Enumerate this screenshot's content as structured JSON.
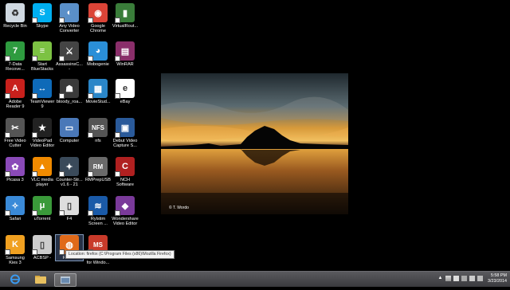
{
  "desktop_icons": [
    {
      "label": "Recycle Bin",
      "icon": "recycle-bin-icon",
      "color": "#cfd8e0",
      "glyph": "♻",
      "shortcut": false
    },
    {
      "label": "Skype",
      "icon": "skype-icon",
      "color": "#00aff0",
      "glyph": "S",
      "shortcut": true
    },
    {
      "label": "Any Video\nConverter",
      "icon": "any-video-converter-icon",
      "color": "#5a8fc8",
      "glyph": "◐",
      "shortcut": true
    },
    {
      "label": "Google\nChrome",
      "icon": "chrome-icon",
      "color": "#db4437",
      "glyph": "◉",
      "shortcut": true
    },
    {
      "label": "VirtualRout...",
      "icon": "virtual-router-icon",
      "color": "#3a7d3a",
      "glyph": "▮",
      "shortcut": true
    },
    {
      "label": "7-Data\nRecove...",
      "icon": "data-recovery-icon",
      "color": "#2e9b3f",
      "glyph": "7",
      "shortcut": true
    },
    {
      "label": "Start\nBlueStacks",
      "icon": "bluestacks-icon",
      "color": "#7cc243",
      "glyph": "≡",
      "shortcut": true
    },
    {
      "label": "AssassinsC...\n-",
      "icon": "assassins-creed-icon",
      "color": "#444444",
      "glyph": "⚔",
      "shortcut": true
    },
    {
      "label": "Mobogenie",
      "icon": "mobogenie-icon",
      "color": "#2a8fd8",
      "glyph": "◕",
      "shortcut": true
    },
    {
      "label": "WinRAR",
      "icon": "winrar-icon",
      "color": "#8a2e6a",
      "glyph": "▤",
      "shortcut": true
    },
    {
      "label": "Adobe\nReader 9",
      "icon": "adobe-reader-icon",
      "color": "#c8201c",
      "glyph": "A",
      "shortcut": true
    },
    {
      "label": "TeamViewer\n9",
      "icon": "teamviewer-icon",
      "color": "#0e6ab8",
      "glyph": "↔",
      "shortcut": true
    },
    {
      "label": "bloody_roa...",
      "icon": "bloody-roar-icon",
      "color": "#3a3a3a",
      "glyph": "☗",
      "shortcut": true
    },
    {
      "label": "MovieStud...",
      "icon": "movie-studio-icon",
      "color": "#2a86c8",
      "glyph": "▦",
      "shortcut": true
    },
    {
      "label": "eBay",
      "icon": "ebay-icon",
      "color": "#ffffff",
      "glyph": "e",
      "shortcut": true
    },
    {
      "label": "Free Video\nCutter",
      "icon": "video-cutter-icon",
      "color": "#555555",
      "glyph": "✂",
      "shortcut": true
    },
    {
      "label": "VideoPad\nVideo Editor",
      "icon": "videopad-icon",
      "color": "#222222",
      "glyph": "★",
      "shortcut": true
    },
    {
      "label": "Computer",
      "icon": "computer-icon",
      "color": "#4a78b8",
      "glyph": "▭",
      "shortcut": false
    },
    {
      "label": "nfs",
      "icon": "nfs-icon",
      "color": "#555555",
      "glyph": "NFS",
      "shortcut": true
    },
    {
      "label": "Debut Video\nCapture S...",
      "icon": "debut-video-icon",
      "color": "#2a5a9a",
      "glyph": "▣",
      "shortcut": true
    },
    {
      "label": "Picasa 3",
      "icon": "picasa-icon",
      "color": "#8a4ab8",
      "glyph": "✿",
      "shortcut": true
    },
    {
      "label": "VLC media\nplayer",
      "icon": "vlc-icon",
      "color": "#f08a00",
      "glyph": "▲",
      "shortcut": true
    },
    {
      "label": "Counter-Str...\nv1.6 - 21",
      "icon": "counter-strike-icon",
      "color": "#3a4a5a",
      "glyph": "✦",
      "shortcut": true
    },
    {
      "label": "RMPrepUSB",
      "icon": "rmprepusb-icon",
      "color": "#6a6a6a",
      "glyph": "RM",
      "shortcut": true
    },
    {
      "label": "NCH\nSoftware",
      "icon": "nch-icon",
      "color": "#b02020",
      "glyph": "C",
      "shortcut": true
    },
    {
      "label": "Safari",
      "icon": "safari-icon",
      "color": "#3a8ad8",
      "glyph": "✧",
      "shortcut": true
    },
    {
      "label": "uTorrent",
      "icon": "utorrent-icon",
      "color": "#3a9a3a",
      "glyph": "μ",
      "shortcut": true
    },
    {
      "label": "F4",
      "icon": "f4-icon",
      "color": "#dddddd",
      "glyph": "▯",
      "shortcut": true
    },
    {
      "label": "Rylstim\nScreen ...",
      "icon": "rylstim-icon",
      "color": "#1a5aa8",
      "glyph": "≋",
      "shortcut": true
    },
    {
      "label": "Wondershare\nVideo Editor",
      "icon": "wondershare-icon",
      "color": "#7a3a9a",
      "glyph": "◆",
      "shortcut": true
    },
    {
      "label": "Samsung\nKies 3",
      "icon": "samsung-kies-icon",
      "color": "#f0a020",
      "glyph": "K",
      "shortcut": true
    },
    {
      "label": "ACBSP -",
      "icon": "acbsp-icon",
      "color": "#cccccc",
      "glyph": "▯",
      "shortcut": true
    },
    {
      "label": "Firefox",
      "icon": "firefox-icon",
      "color": "#e06a1a",
      "glyph": "◍",
      "shortcut": true,
      "selected": true
    },
    {
      "label": "TurboC++\nfor Windo...",
      "icon": "turboc-icon",
      "color": "#c83a2a",
      "glyph": "MS",
      "shortcut": true
    }
  ],
  "wallpaper": {
    "credit": "© T. Wordo",
    "colors": {
      "sky_top": "#2e3a40",
      "sky_glow": "#e8a13a",
      "water": "#7a4a1a",
      "mountain": "#050505"
    }
  },
  "tooltip": {
    "text": "Location: firefox (C:\\Program Files (x86)\\Mozilla Firefox)"
  },
  "taskbar": {
    "buttons": [
      {
        "icon": "internet-explorer-icon",
        "color": "#2a7ad8"
      },
      {
        "icon": "file-explorer-icon",
        "color": "#e8c060"
      },
      {
        "icon": "active-window-icon",
        "color": "#9ab0c8"
      }
    ],
    "tray_icons": [
      "up-arrow-icon",
      "network-icon",
      "flag-icon",
      "battery-icon",
      "volume-icon",
      "keyboard-icon"
    ],
    "time": "5:58 PM",
    "date": "3/23/2014"
  }
}
